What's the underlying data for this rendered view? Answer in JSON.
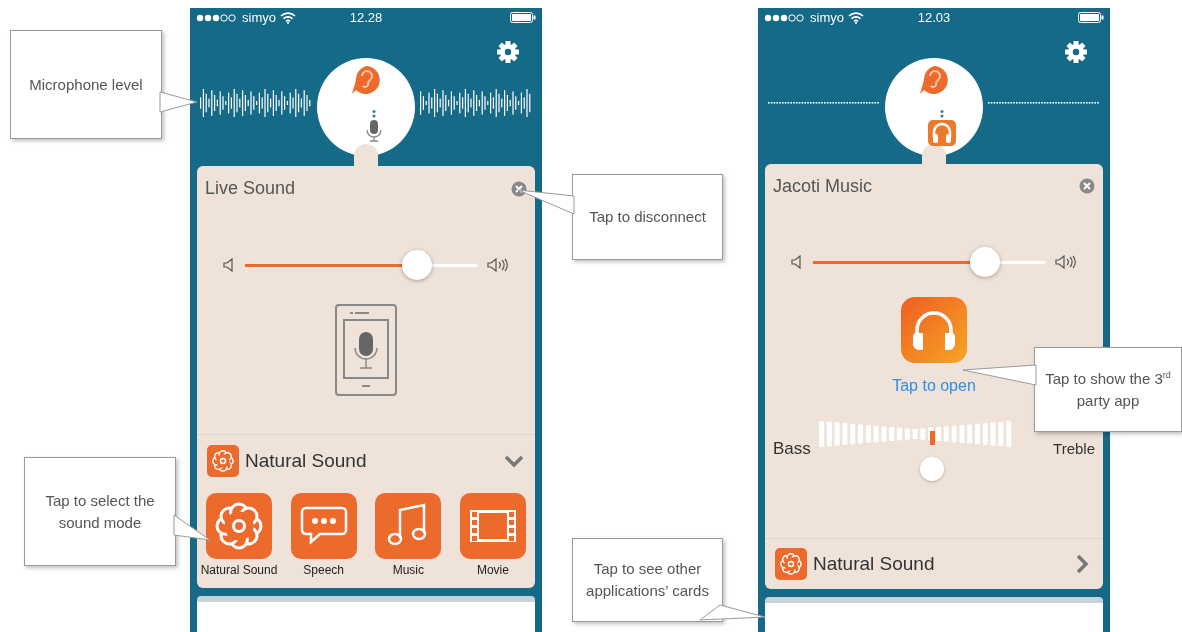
{
  "screens": [
    {
      "kind": "live",
      "status": {
        "carrier": "simyo",
        "time": "12.28"
      },
      "card": {
        "title": "Live Sound",
        "volume": {
          "level": 0.74
        },
        "content": {
          "kind": "device"
        },
        "mode": {
          "label": "Natural Sound",
          "expanded": true
        },
        "modes": [
          {
            "label": "Natural Sound",
            "kind": "flower"
          },
          {
            "label": "Speech",
            "kind": "speech"
          },
          {
            "label": "Music",
            "kind": "music"
          },
          {
            "label": "Movie",
            "kind": "movie"
          }
        ]
      }
    },
    {
      "kind": "app",
      "status": {
        "carrier": "simyo",
        "time": "12.03"
      },
      "card": {
        "title": "Jacoti Music",
        "volume": {
          "level": 0.74
        },
        "content": {
          "kind": "app",
          "open_label": "Tap to open",
          "eq": {
            "bass_label": "Bass",
            "treble_label": "Treble",
            "level": 0.5
          }
        },
        "mode": {
          "label": "Natural Sound",
          "expanded": false
        }
      }
    }
  ],
  "callouts": [
    {
      "text": "Microphone level"
    },
    {
      "text": "Tap to disconnect"
    },
    {
      "text": "Tap to select the sound mode"
    },
    {
      "text": "Tap to show the 3$^{rd}$ party app"
    },
    {
      "text": "Tap to see other applications’ cards"
    }
  ]
}
